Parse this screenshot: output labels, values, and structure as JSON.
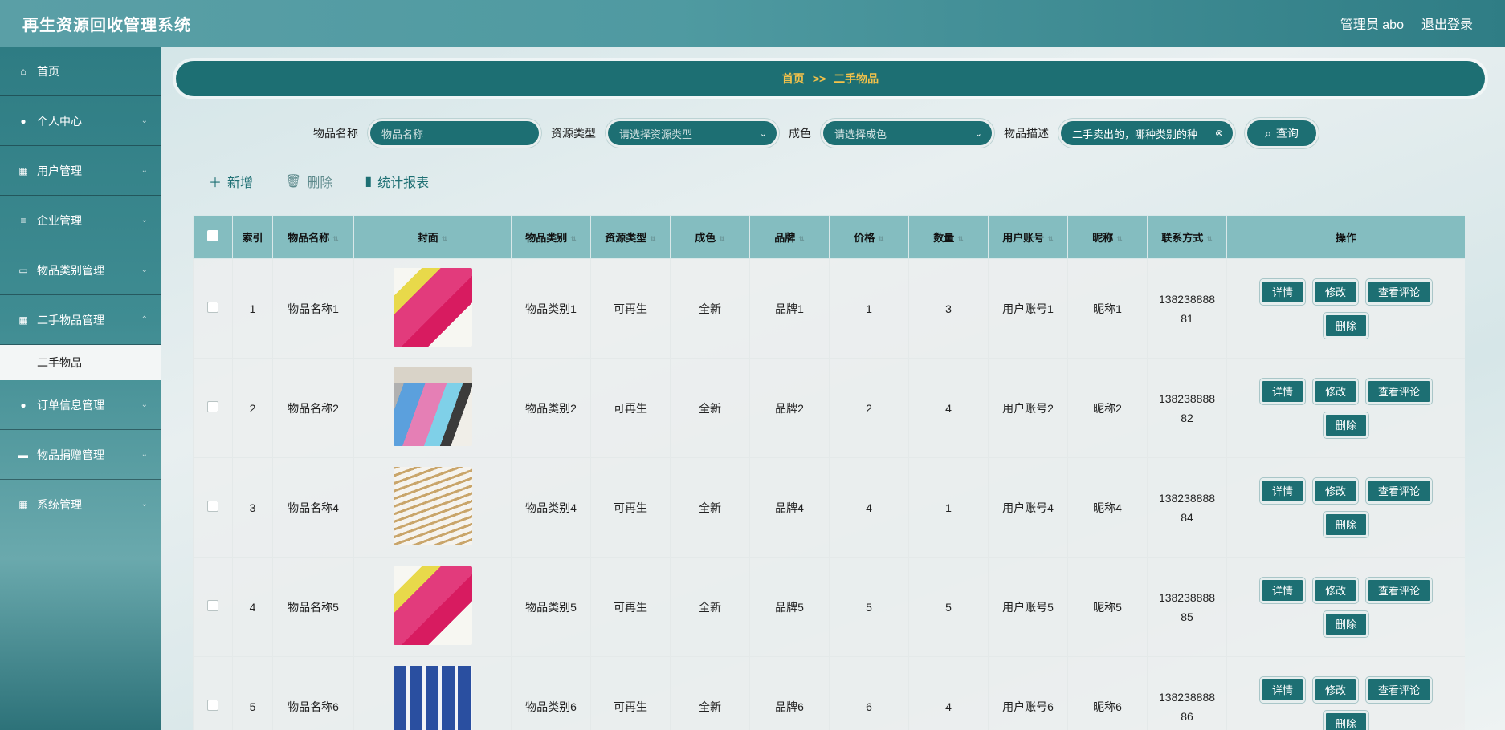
{
  "header": {
    "title": "再生资源回收管理系统",
    "user": "管理员 abo",
    "logout": "退出登录"
  },
  "sidebar": {
    "items": [
      {
        "label": "首页",
        "icon": "home-icon"
      },
      {
        "label": "个人中心",
        "icon": "user-icon"
      },
      {
        "label": "用户管理",
        "icon": "grid-icon"
      },
      {
        "label": "企业管理",
        "icon": "list-icon"
      },
      {
        "label": "物品类别管理",
        "icon": "monitor-icon"
      },
      {
        "label": "二手物品管理",
        "icon": "grid-icon"
      },
      {
        "label": "订单信息管理",
        "icon": "user-icon"
      },
      {
        "label": "物品捐赠管理",
        "icon": "chat-icon"
      },
      {
        "label": "系统管理",
        "icon": "grid-icon"
      }
    ],
    "active_sub": "二手物品"
  },
  "breadcrumb": {
    "home": "首页",
    "sep": ">>",
    "current": "二手物品"
  },
  "search": {
    "name_label": "物品名称",
    "name_placeholder": "物品名称",
    "type_label": "资源类型",
    "type_placeholder": "请选择资源类型",
    "cond_label": "成色",
    "cond_placeholder": "请选择成色",
    "desc_label": "物品描述",
    "desc_value": "二手卖出的，哪种类别的种",
    "query": "查询"
  },
  "actions": {
    "add": "新增",
    "delete": "删除",
    "report": "统计报表"
  },
  "table": {
    "headers": [
      "索引",
      "物品名称",
      "封面",
      "物品类别",
      "资源类型",
      "成色",
      "品牌",
      "价格",
      "数量",
      "用户账号",
      "昵称",
      "联系方式",
      "操作"
    ],
    "rows": [
      {
        "index": "1",
        "name": "物品名称1",
        "category": "物品类别1",
        "type": "可再生",
        "cond": "全新",
        "brand": "品牌1",
        "price": "1",
        "qty": "3",
        "account": "用户账号1",
        "nick": "昵称1",
        "phone1": "138238888",
        "phone2": "81"
      },
      {
        "index": "2",
        "name": "物品名称2",
        "category": "物品类别2",
        "type": "可再生",
        "cond": "全新",
        "brand": "品牌2",
        "price": "2",
        "qty": "4",
        "account": "用户账号2",
        "nick": "昵称2",
        "phone1": "138238888",
        "phone2": "82"
      },
      {
        "index": "3",
        "name": "物品名称4",
        "category": "物品类别4",
        "type": "可再生",
        "cond": "全新",
        "brand": "品牌4",
        "price": "4",
        "qty": "1",
        "account": "用户账号4",
        "nick": "昵称4",
        "phone1": "138238888",
        "phone2": "84"
      },
      {
        "index": "4",
        "name": "物品名称5",
        "category": "物品类别5",
        "type": "可再生",
        "cond": "全新",
        "brand": "品牌5",
        "price": "5",
        "qty": "5",
        "account": "用户账号5",
        "nick": "昵称5",
        "phone1": "138238888",
        "phone2": "85"
      },
      {
        "index": "5",
        "name": "物品名称6",
        "category": "物品类别6",
        "type": "可再生",
        "cond": "全新",
        "brand": "品牌6",
        "price": "6",
        "qty": "4",
        "account": "用户账号6",
        "nick": "昵称6",
        "phone1": "138238888",
        "phone2": "86"
      }
    ],
    "ops": {
      "detail": "详情",
      "edit": "修改",
      "comments": "查看评论",
      "delete": "删除"
    }
  }
}
